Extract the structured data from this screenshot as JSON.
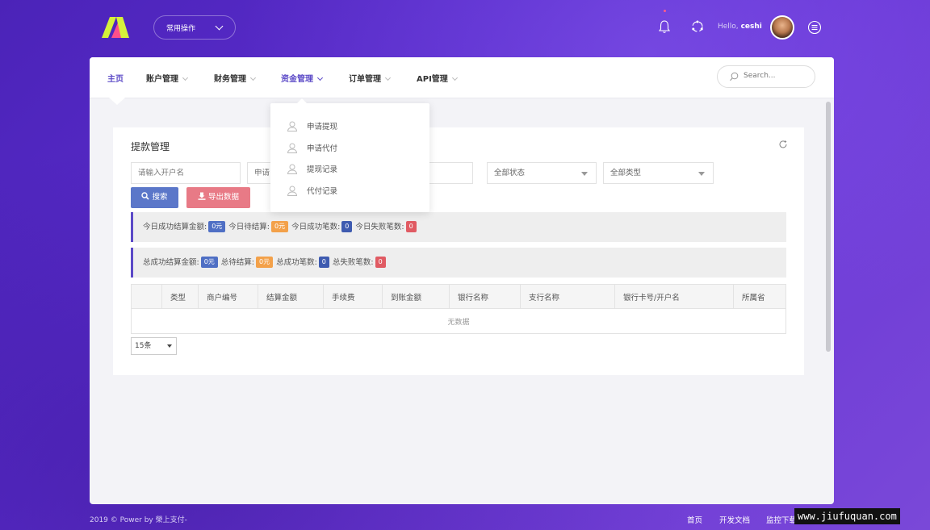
{
  "header": {
    "quick_menu_label": "常用操作",
    "hello_prefix": "Hello,",
    "username": "ceshi"
  },
  "nav": {
    "items": [
      {
        "label": "主页"
      },
      {
        "label": "账户管理"
      },
      {
        "label": "财务管理"
      },
      {
        "label": "资金管理"
      },
      {
        "label": "订单管理"
      },
      {
        "label": "API管理"
      }
    ],
    "search_placeholder": "Search..."
  },
  "dropdown": {
    "items": [
      {
        "label": "申请提现"
      },
      {
        "label": "申请代付"
      },
      {
        "label": "提现记录"
      },
      {
        "label": "代付记录"
      }
    ]
  },
  "card": {
    "title": "提款管理",
    "filters": {
      "account_placeholder": "请输入开户名",
      "apply_placeholder": "申请",
      "status_selected": "全部状态",
      "type_selected": "全部类型"
    },
    "buttons": {
      "search": "搜索",
      "export": "导出数据"
    },
    "today_stats": {
      "settled_label": "今日成功结算金额:",
      "settled_value": "0元",
      "pending_label": "今日待结算:",
      "pending_value": "0元",
      "success_count_label": "今日成功笔数:",
      "success_count_value": "0",
      "fail_count_label": "今日失败笔数:",
      "fail_count_value": "0"
    },
    "total_stats": {
      "settled_label": "总成功结算金额:",
      "settled_value": "0元",
      "pending_label": "总待结算:",
      "pending_value": "0元",
      "success_count_label": "总成功笔数:",
      "success_count_value": "0",
      "fail_count_label": "总失败笔数:",
      "fail_count_value": "0"
    },
    "table": {
      "columns": [
        "",
        "类型",
        "商户编号",
        "结算金额",
        "手续费",
        "到账金额",
        "银行名称",
        "支行名称",
        "银行卡号/开户名",
        "所属省"
      ],
      "empty_text": "无数据"
    },
    "page_size": "15条"
  },
  "footer": {
    "copyright": "2019 © Power by 榮上支付-",
    "links": [
      "首页",
      "开发文档",
      "监控下载"
    ]
  },
  "watermark": "www.jiufuquan.com",
  "colors": {
    "accent": "#5b49c7",
    "search_button": "#5b77c9",
    "export_button": "#e87a86",
    "badge_blue": "#4f6fc4",
    "badge_orange": "#f3a14a",
    "badge_red": "#e05b63"
  }
}
